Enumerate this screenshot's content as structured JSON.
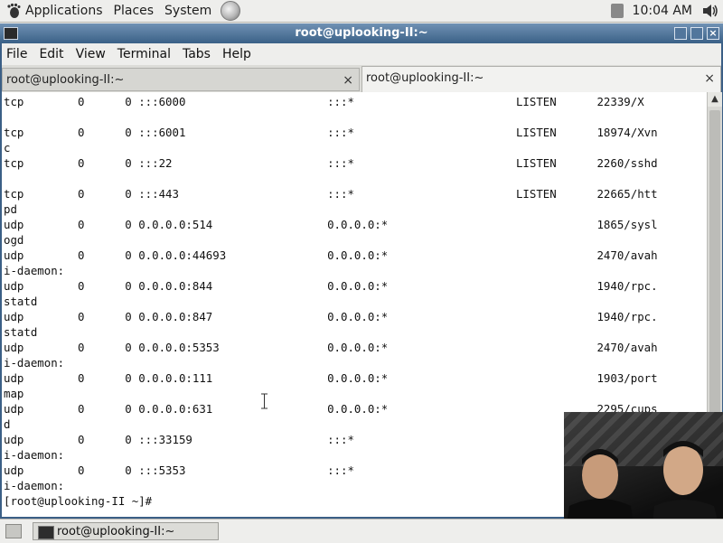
{
  "top_panel": {
    "menus": [
      "Applications",
      "Places",
      "System"
    ],
    "clock": "10:04 AM"
  },
  "window": {
    "title": "root@uplooking-II:~",
    "menu": [
      "File",
      "Edit",
      "View",
      "Terminal",
      "Tabs",
      "Help"
    ],
    "tabs": [
      {
        "label": "root@uplooking-II:~",
        "active": false
      },
      {
        "label": "root@uplooking-II:~",
        "active": true
      }
    ]
  },
  "terminal": {
    "lines": [
      "tcp        0      0 :::6000                     :::*                        LISTEN      22339/X",
      "",
      "tcp        0      0 :::6001                     :::*                        LISTEN      18974/Xvn",
      "c",
      "tcp        0      0 :::22                       :::*                        LISTEN      2260/sshd",
      "",
      "tcp        0      0 :::443                      :::*                        LISTEN      22665/htt",
      "pd",
      "udp        0      0 0.0.0.0:514                 0.0.0.0:*                               1865/sysl",
      "ogd",
      "udp        0      0 0.0.0.0:44693               0.0.0.0:*                               2470/avah",
      "i-daemon:",
      "udp        0      0 0.0.0.0:844                 0.0.0.0:*                               1940/rpc.",
      "statd",
      "udp        0      0 0.0.0.0:847                 0.0.0.0:*                               1940/rpc.",
      "statd",
      "udp        0      0 0.0.0.0:5353                0.0.0.0:*                               2470/avah",
      "i-daemon:",
      "udp        0      0 0.0.0.0:111                 0.0.0.0:*                               1903/port",
      "map",
      "udp        0      0 0.0.0.0:631                 0.0.0.0:*                               2295/cups",
      "d",
      "udp        0      0 :::33159                    :::*                                    ",
      "i-daemon:",
      "udp        0      0 :::5353                     :::*                                    ",
      "i-daemon:",
      "[root@uplooking-II ~]#"
    ]
  },
  "taskbar": {
    "items": [
      "root@uplooking-II:~"
    ]
  },
  "colors": {
    "titlebar": "#3a6187",
    "terminal_bg": "#ffffff",
    "panel_bg": "#eeeeec"
  },
  "icons": {
    "panel": [
      "gnome-foot-icon",
      "web-browser-icon",
      "network-icon",
      "volume-icon"
    ],
    "window": [
      "terminal-icon",
      "minimize-icon",
      "maximize-icon",
      "close-icon"
    ]
  }
}
